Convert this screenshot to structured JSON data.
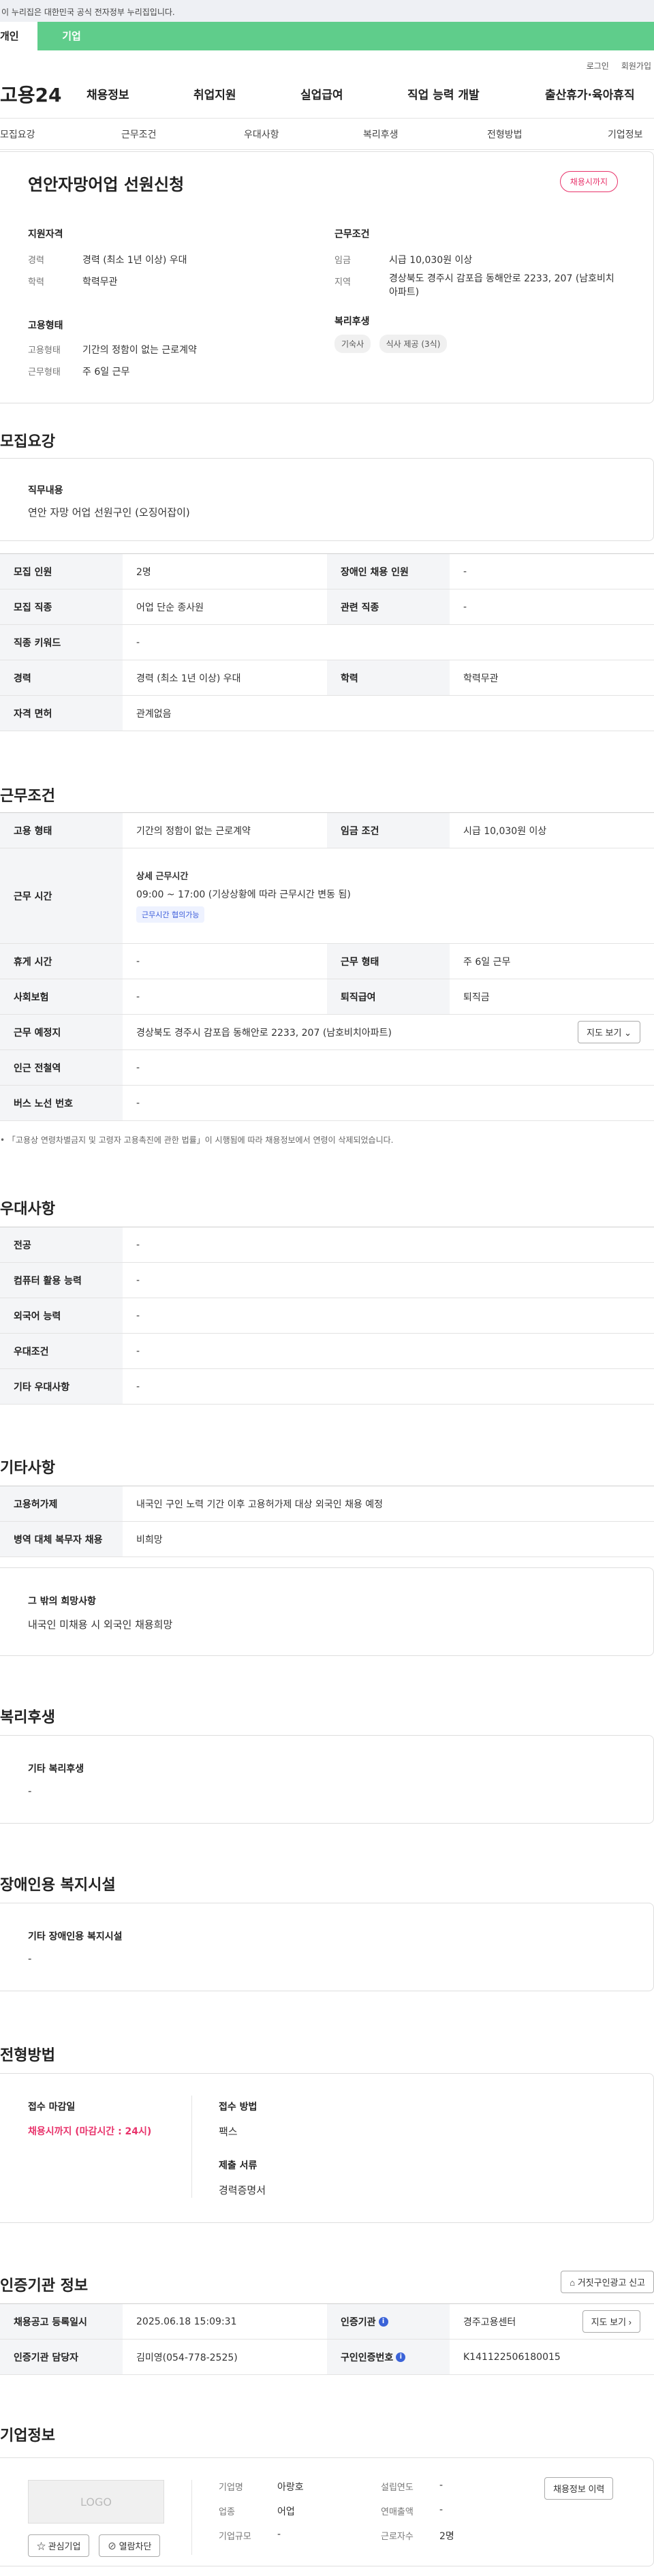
{
  "gov_banner": "이 누리집은 대한민국 공식 전자정부 누리집입니다.",
  "user_tabs": [
    "개인",
    "기업"
  ],
  "util_links": [
    "로그인",
    "회원가입"
  ],
  "logo": "고용24",
  "gnb": [
    "채용정보",
    "취업지원",
    "실업급여",
    "직업 능력 개발",
    "출산휴가·육아휴직"
  ],
  "subnav": [
    "모집요강",
    "근무조건",
    "우대사항",
    "복리후생",
    "전형방법",
    "기업정보"
  ],
  "job": {
    "title": "연안자망어업 선원신청",
    "status_badge": "채용시까지",
    "apply_head": "지원자격",
    "career_label": "경력",
    "career_value": "경력 (최소 1년 이상) 우대",
    "edu_label": "학력",
    "edu_value": "학력무관",
    "cond_head": "근무조건",
    "wage_label": "임금",
    "wage_value": "시급 10,030원 이상",
    "region_label": "지역",
    "region_value": "경상북도 경주시 감포읍 동해안로 2233, 207 (남호비치아파트)",
    "emp_head": "고용형태",
    "emp_label": "고용형태",
    "emp_value": "기간의 정함이 없는 근로계약",
    "work_label": "근무형태",
    "work_value": "주 6일 근무",
    "welfare_head": "복리후생",
    "welfare_chips": [
      "기숙사",
      "식사 제공 (3식)"
    ]
  },
  "recruit": {
    "title": "모집요강",
    "duty_label": "직무내용",
    "duty_value": "연안 자망 어업 선원구인 (오징어잡이)",
    "rows": [
      {
        "h1": "모집 인원",
        "v1": "2명",
        "h2": "장애인 채용 인원",
        "v2": "-"
      },
      {
        "h1": "모집 직종",
        "v1": "어업 단순 종사원",
        "h2": "관련 직종",
        "v2": "-"
      }
    ],
    "keyword_h": "직종 키워드",
    "keyword_v": "-",
    "career_h": "경력",
    "career_v": "경력 (최소 1년 이상) 우대",
    "edu_h": "학력",
    "edu_v": "학력무관",
    "license_h": "자격 면허",
    "license_v": "관계없음"
  },
  "conditions": {
    "title": "근무조건",
    "emp_h": "고용 형태",
    "emp_v": "기간의 정함이 없는 근로계약",
    "wage_h": "임금 조건",
    "wage_v": "시급 10,030원 이상",
    "time_h": "근무 시간",
    "time_sub": "상세 근무시간",
    "time_v": "09:00 ~ 17:00 (기상상황에 따라 근무시간 변동 됨)",
    "time_chip": "근무시간 협의가능",
    "rest_h": "휴게 시간",
    "rest_v": "-",
    "form_h": "근무 형태",
    "form_v": "주 6일 근무",
    "insure_h": "사회보험",
    "insure_v": "-",
    "retire_h": "퇴직급여",
    "retire_v": "퇴직금",
    "place_h": "근무 예정지",
    "place_v": "경상북도 경주시 감포읍 동해안로 2233, 207 (남호비치아파트)",
    "map_btn": "지도 보기",
    "subway_h": "인근 전철역",
    "subway_v": "-",
    "bus_h": "버스 노선 번호",
    "bus_v": "-",
    "note": "「고용상 연령차별금지 및 고령자 고용촉진에 관한 법률」이 시행됨에 따라 채용정보에서 연령이 삭제되었습니다."
  },
  "prefer": {
    "title": "우대사항",
    "rows": [
      {
        "h": "전공",
        "v": "-"
      },
      {
        "h": "컴퓨터 활용 능력",
        "v": "-"
      },
      {
        "h": "외국어 능력",
        "v": "-"
      },
      {
        "h": "우대조건",
        "v": "-"
      },
      {
        "h": "기타 우대사항",
        "v": "-"
      }
    ]
  },
  "etc": {
    "title": "기타사항",
    "rows": [
      {
        "h": "고용허가제",
        "v": "내국인 구인 노력 기간 이후 고용허가제 대상 외국인 채용 예정"
      },
      {
        "h": "병역 대체 복무자 채용",
        "v": "비희망"
      }
    ],
    "hope_label": "그 밖의 희망사항",
    "hope_value": "내국인 미채용 시 외국인 채용희망"
  },
  "welfare": {
    "title": "복리후생",
    "label": "기타 복리후생",
    "value": "-"
  },
  "disabled": {
    "title": "장애인용 복지시설",
    "label": "기타 장애인용 복지시설",
    "value": "-"
  },
  "selection": {
    "title": "전형방법",
    "deadline_label": "접수 마감일",
    "deadline_value": "채용시까지 (마감시간 : 24시)",
    "method_label": "접수 방법",
    "method_value": "팩스",
    "docs_label": "제출 서류",
    "docs_value": "경력증명서"
  },
  "cert": {
    "title": "인증기관 정보",
    "report_btn": "거짓구인광고 신고",
    "reg_h": "채용공고 등록일시",
    "reg_v": "2025.06.18 15:09:31",
    "org_h": "인증기관",
    "org_v": "경주고용센터",
    "map_btn": "지도 보기",
    "manager_h": "인증기관 담당자",
    "manager_v": "김미영(054-778-2525)",
    "cert_no_h": "구인인증번호",
    "cert_no_v": "K141122506180015",
    "info_icon": "i"
  },
  "company": {
    "title": "기업정보",
    "logo_text": "LOGO",
    "fav_btn": "관심기업",
    "block_btn": "열람차단",
    "history_btn": "채용정보 이력",
    "name_h": "기업명",
    "name_v": "아랑호",
    "industry_h": "업종",
    "industry_v": "어업",
    "size_h": "기업규모",
    "size_v": "-",
    "founded_h": "설립연도",
    "founded_v": "-",
    "sales_h": "연매출액",
    "sales_v": "-",
    "emp_h": "근로자수",
    "emp_v": "2명"
  },
  "colors": {
    "brand_green": "#5fcd8b",
    "accent_pink": "#e8336b",
    "link_blue": "#3b63d8"
  }
}
